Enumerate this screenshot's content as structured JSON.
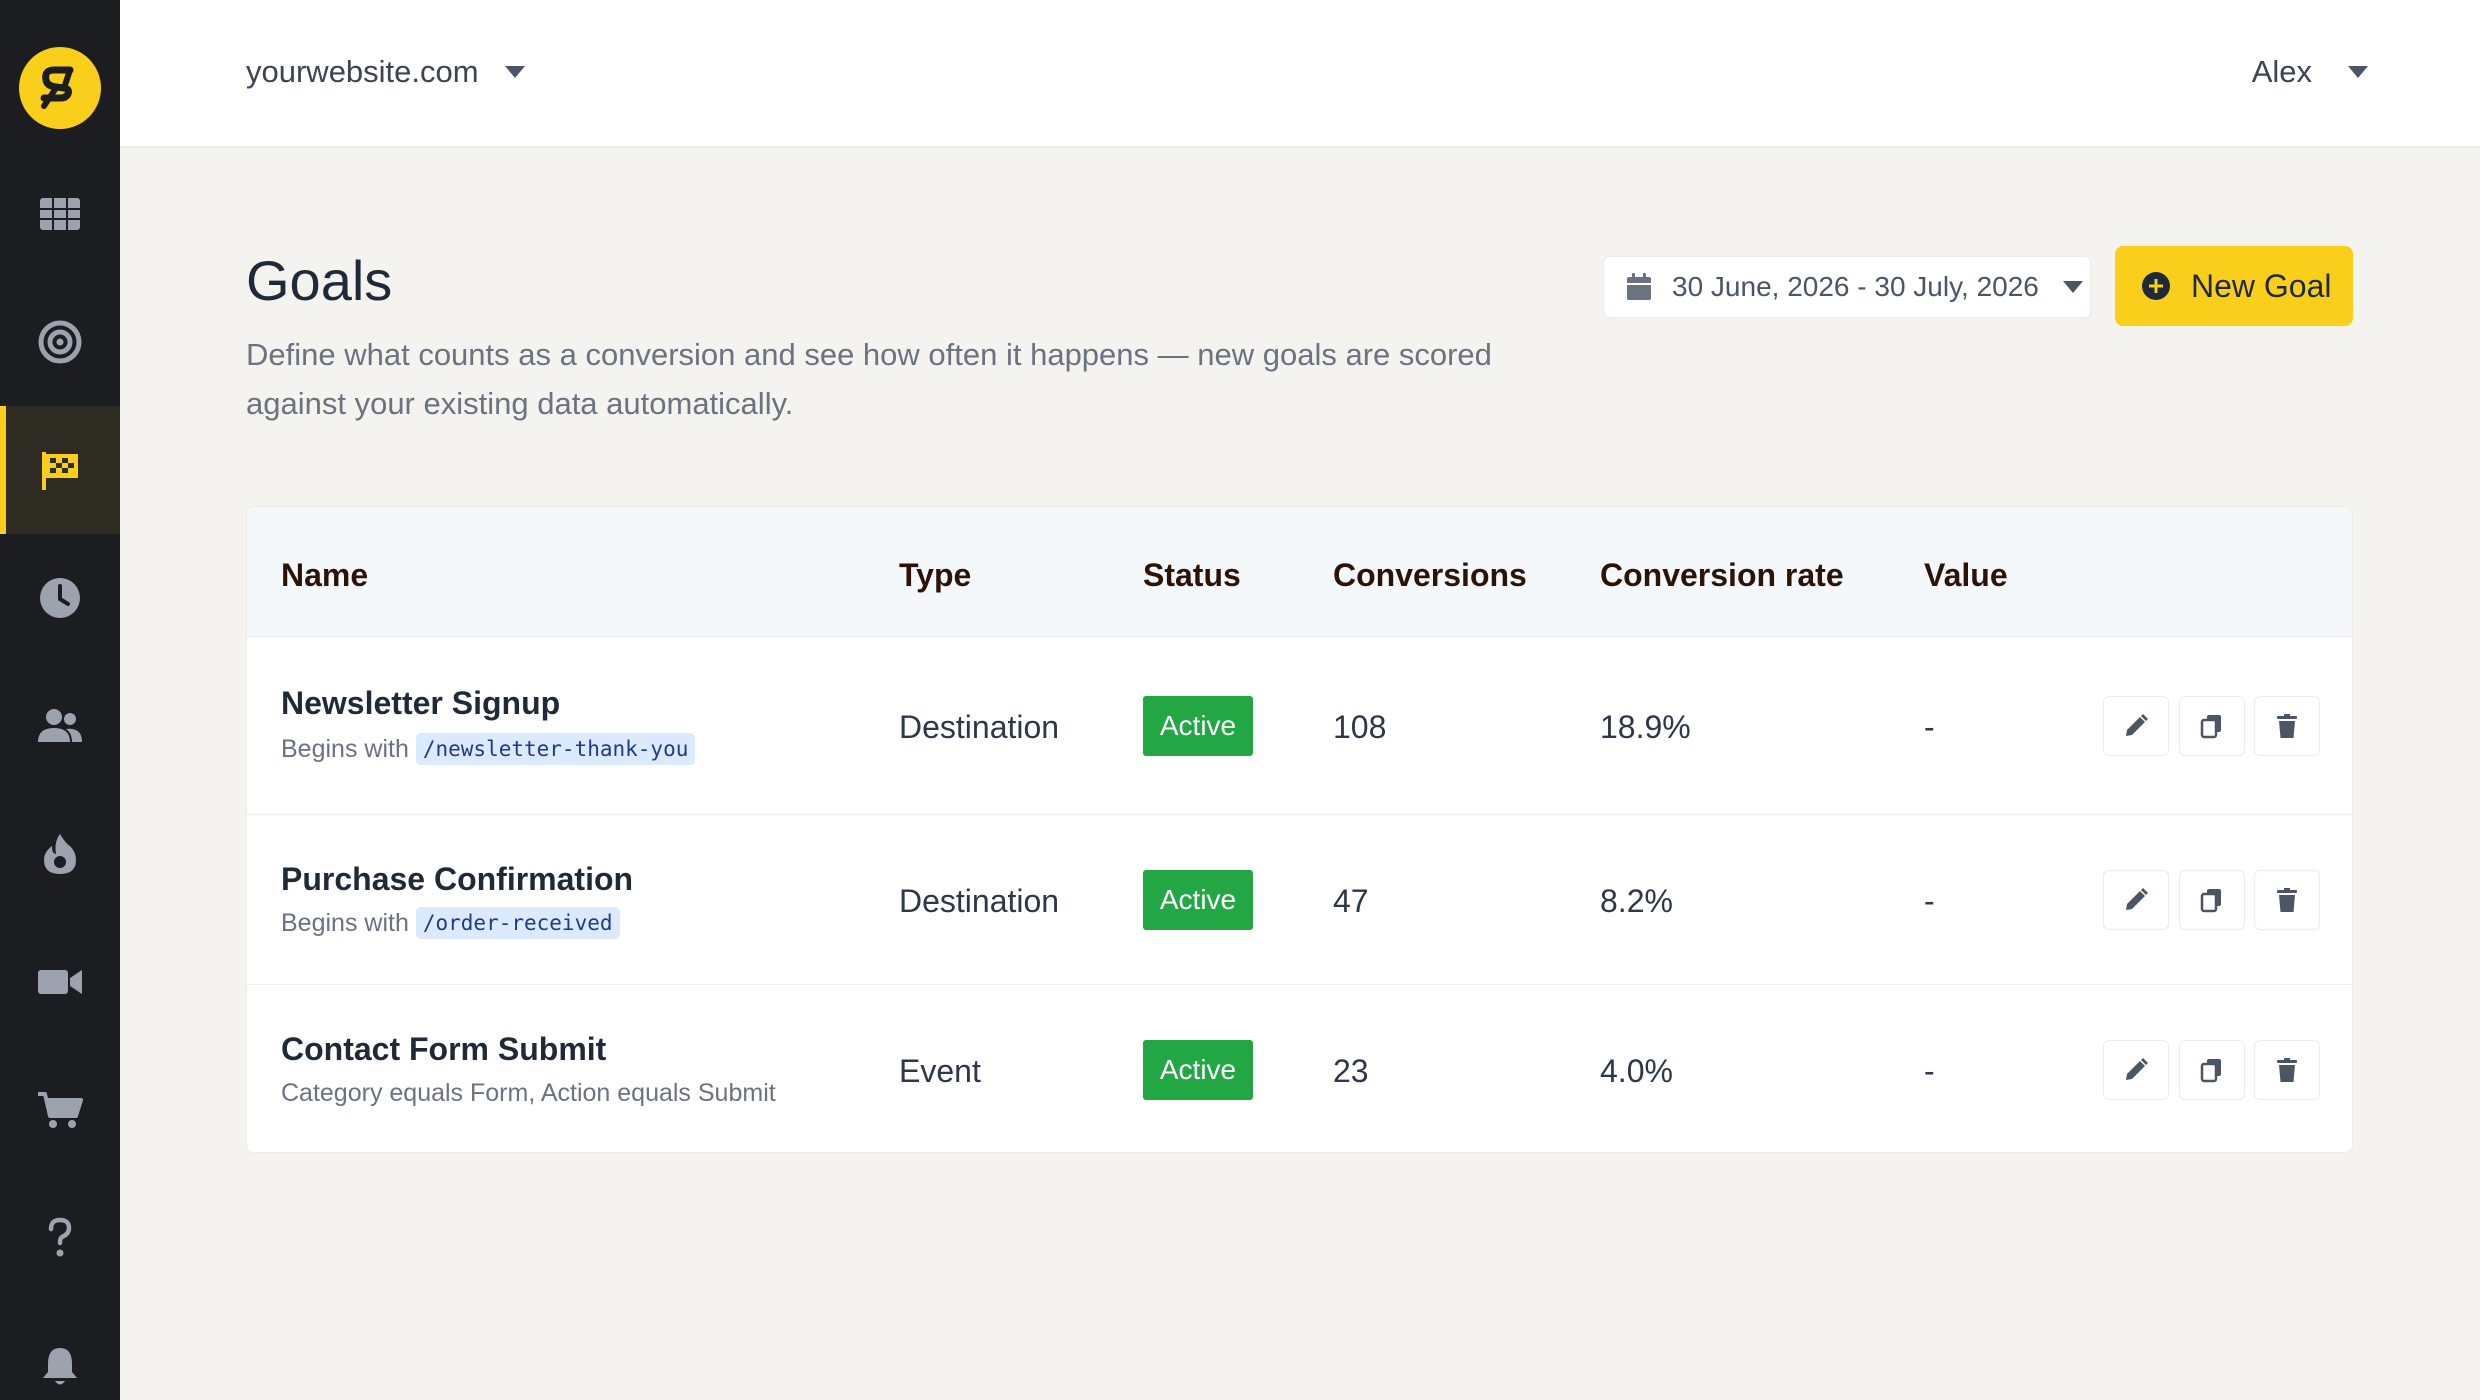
{
  "topbar": {
    "site": "yourwebsite.com",
    "user": "Alex"
  },
  "sidebar": {
    "items": [
      {
        "name": "dashboard",
        "icon": "grid-icon",
        "active": false
      },
      {
        "name": "goals-target",
        "icon": "target-icon",
        "active": false
      },
      {
        "name": "goals",
        "icon": "checkered-flag-icon",
        "active": true
      },
      {
        "name": "realtime",
        "icon": "clock-icon",
        "active": false
      },
      {
        "name": "visitors",
        "icon": "users-icon",
        "active": false
      },
      {
        "name": "heatmaps",
        "icon": "fire-icon",
        "active": false
      },
      {
        "name": "recordings",
        "icon": "video-camera-icon",
        "active": false
      },
      {
        "name": "ecommerce",
        "icon": "shopping-cart-icon",
        "active": false
      },
      {
        "name": "help",
        "icon": "question-icon",
        "active": false
      },
      {
        "name": "notifications",
        "icon": "bell-icon",
        "active": false
      }
    ]
  },
  "page": {
    "title": "Goals",
    "description": "Define what counts as a conversion and see how often it happens — new goals are scored against your existing data automatically.",
    "date_range": "30 June, 2026 - 30 July, 2026",
    "new_goal_label": "New Goal"
  },
  "table": {
    "columns": [
      "Name",
      "Type",
      "Status",
      "Conversions",
      "Conversion rate",
      "Value"
    ],
    "rows": [
      {
        "name": "Newsletter Signup",
        "rule_prefix": "Begins with",
        "rule_code": "/newsletter-thank-you",
        "rule_text": "",
        "type": "Destination",
        "status": "Active",
        "conversions": "108",
        "rate": "18.9%",
        "value": "-"
      },
      {
        "name": "Purchase Confirmation",
        "rule_prefix": "Begins with",
        "rule_code": "/order-received",
        "rule_text": "",
        "type": "Destination",
        "status": "Active",
        "conversions": "47",
        "rate": "8.2%",
        "value": "-"
      },
      {
        "name": "Contact Form Submit",
        "rule_prefix": "",
        "rule_code": "",
        "rule_text": "Category equals Form, Action equals Submit",
        "type": "Event",
        "status": "Active",
        "conversions": "23",
        "rate": "4.0%",
        "value": "-"
      }
    ]
  },
  "colors": {
    "sidebar_bg": "#1b1d20",
    "accent": "#f9cf1c",
    "active_badge": "#22a744",
    "page_bg": "#f4f3ef"
  }
}
